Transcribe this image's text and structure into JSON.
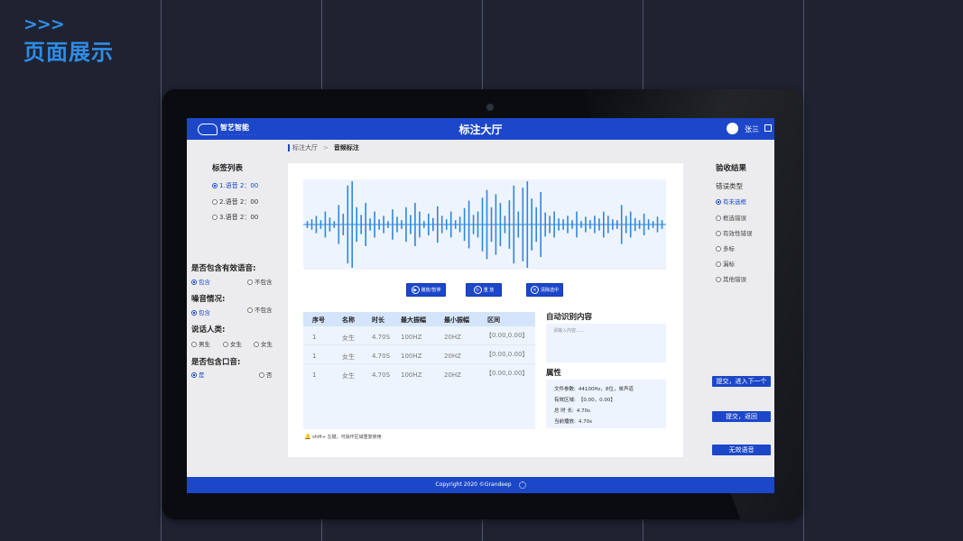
{
  "showcase": {
    "arrows": ">>>",
    "title": "页面展示"
  },
  "app": {
    "logo_text": "智艺智能",
    "logo_sub": "· · · · · · · · · ·",
    "title": "标注大厅",
    "username": "张三"
  },
  "breadcrumb": {
    "parent": "标注大厅",
    "separator": ">",
    "current": "音频标注"
  },
  "labels": {
    "title": "标签列表",
    "items": [
      {
        "text": "1.语音  2：00",
        "selected": true
      },
      {
        "text": "2.语音  2：00",
        "selected": false
      },
      {
        "text": "3.语音  2：00",
        "selected": false
      }
    ]
  },
  "questions": [
    {
      "title": "是否包含有效语音:",
      "options": [
        {
          "text": "包含",
          "selected": true
        },
        {
          "text": "不包含",
          "selected": false
        }
      ]
    },
    {
      "title": "噪音情况:",
      "options": [
        {
          "text": "包含",
          "selected": true
        },
        {
          "text": "不包含",
          "selected": false
        }
      ]
    },
    {
      "title": "说话人类:",
      "options": [
        {
          "text": "男生",
          "selected": false
        },
        {
          "text": "女生",
          "selected": false
        },
        {
          "text": "女生",
          "selected": false
        }
      ]
    },
    {
      "title": "是否包含口音:",
      "options": [
        {
          "text": "是",
          "selected": true
        },
        {
          "text": "否",
          "selected": false
        }
      ]
    }
  ],
  "waveform": {
    "color": "#2e86de",
    "levels": [
      0.08,
      0.12,
      0.2,
      0.1,
      0.3,
      0.16,
      0.08,
      0.45,
      0.25,
      0.9,
      1.0,
      0.4,
      0.22,
      0.5,
      0.14,
      0.3,
      0.12,
      0.2,
      0.08,
      0.35,
      0.18,
      0.1,
      0.4,
      0.22,
      0.5,
      0.3,
      0.08,
      0.25,
      0.15,
      0.42,
      0.2,
      0.12,
      0.3,
      0.1,
      0.18,
      0.38,
      0.55,
      0.22,
      0.3,
      0.62,
      0.8,
      0.4,
      0.7,
      0.5,
      0.2,
      0.56,
      0.9,
      0.3,
      0.85,
      1.0,
      0.6,
      0.4,
      0.75,
      0.28,
      0.2,
      0.3,
      0.14,
      0.12,
      0.2,
      0.1,
      0.3,
      0.08,
      0.18,
      0.1,
      0.2,
      0.14,
      0.3,
      0.2,
      0.12,
      0.1,
      0.45,
      0.2,
      0.3,
      0.15,
      0.1,
      0.25,
      0.12,
      0.08,
      0.18,
      0.1
    ]
  },
  "controls": {
    "play": {
      "icon": "▶",
      "label": "播放/暂停"
    },
    "replay": {
      "icon": "↻",
      "label": "重  放"
    },
    "clear": {
      "icon": "✕",
      "label": "清除选中"
    }
  },
  "table": {
    "headers": [
      "序号",
      "名称",
      "时长",
      "最大振幅",
      "最小振幅",
      "区间"
    ],
    "rows": [
      [
        "1",
        "女生",
        "4.70S",
        "100HZ",
        "20HZ",
        "【0.00,0.00】"
      ],
      [
        "1",
        "女生",
        "4.70S",
        "100HZ",
        "20HZ",
        "【0.00,0.00】"
      ],
      [
        "1",
        "女生",
        "4.70S",
        "100HZ",
        "20HZ",
        "【0.00,0.00】"
      ]
    ],
    "hint": "shift+ 左键，可操作区域重复使用"
  },
  "recognition": {
    "title": "自动识别内容",
    "placeholder": "请输入内容......"
  },
  "attributes": {
    "title": "属性",
    "items": [
      {
        "key": "文件参数:",
        "value": "44100Hz，8位，单声道"
      },
      {
        "key": "有效区域:",
        "value": "【0.00，0.00】"
      },
      {
        "key": "总 时 长:",
        "value": "4.70s"
      },
      {
        "key": "当前播放:",
        "value": "4.70s"
      }
    ]
  },
  "review": {
    "title": "验收结果",
    "subtitle": "错误类型",
    "options": [
      {
        "text": "有未选框",
        "selected": true
      },
      {
        "text": "框选错误",
        "selected": false
      },
      {
        "text": "有效性错误",
        "selected": false
      },
      {
        "text": "多标",
        "selected": false
      },
      {
        "text": "漏标",
        "selected": false
      },
      {
        "text": "其他错误",
        "selected": false
      }
    ]
  },
  "actions": {
    "submit_next": "提交，进入下一个",
    "submit_back": "提交，返回",
    "invalid": "无效语音"
  },
  "footer": {
    "copyright": "Copyright 2020 ©Grandeep"
  }
}
